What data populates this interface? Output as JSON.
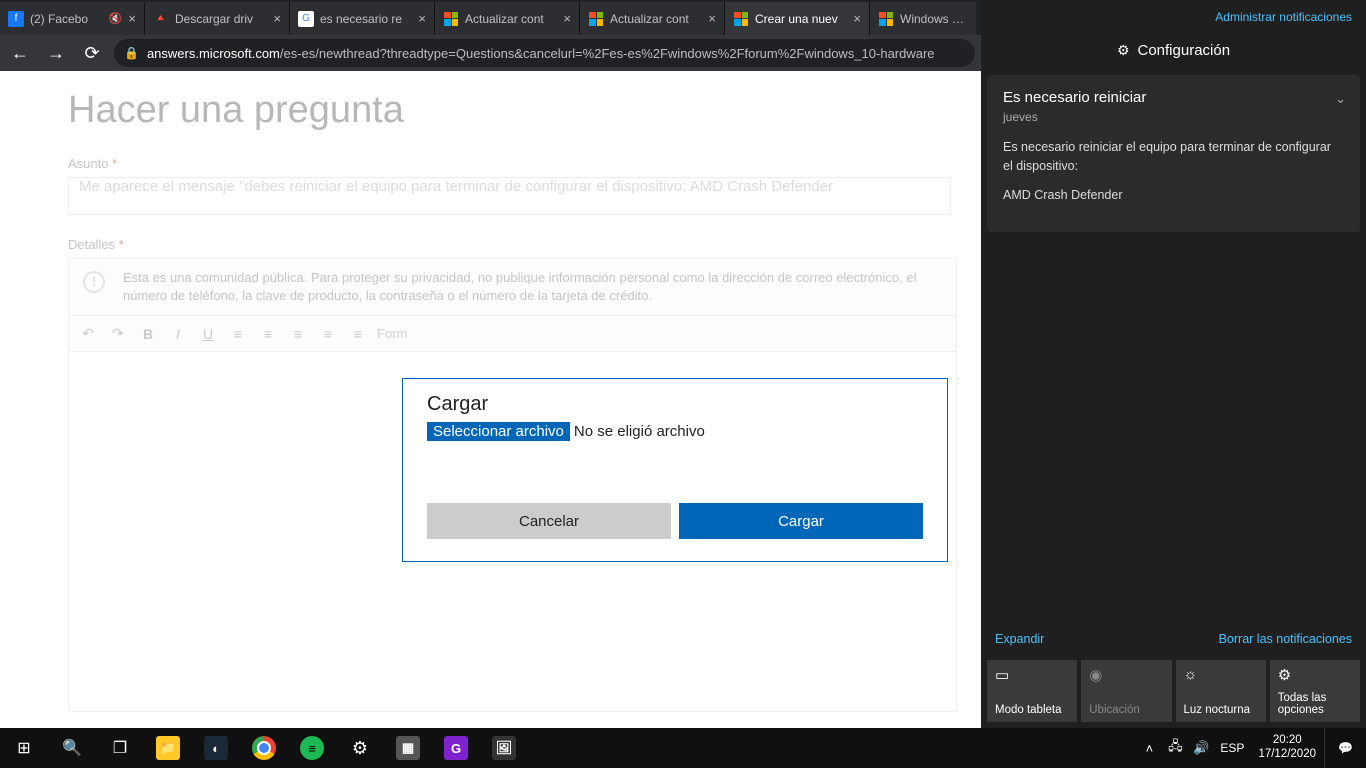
{
  "tabs": [
    {
      "title": "(2) Facebo",
      "muted": true
    },
    {
      "title": "Descargar driv"
    },
    {
      "title": "es necesario re"
    },
    {
      "title": "Actualizar cont"
    },
    {
      "title": "Actualizar cont"
    },
    {
      "title": "Crear una nuev",
      "active": true
    },
    {
      "title": "Windows Hard"
    }
  ],
  "url": {
    "host": "answers.microsoft.com",
    "path": "/es-es/newthread?threadtype=Questions&cancelurl=%2Fes-es%2Fwindows%2Fforum%2Fwindows_10-hardware"
  },
  "page": {
    "title": "Hacer una pregunta",
    "subject_label": "Asunto",
    "subject_value": "Me aparece el mensaje \"debes reiniciar el equipo para terminar de configurar el dispositivo: AMD Crash Defender",
    "details_label": "Detalles",
    "notice": "Esta es una comunidad pública. Para proteger su privacidad, no publique información personal como la dirección de correo electrónico, el número de teléfono, la clave de producto, la contraseña o el número de la tarjeta de crédito.",
    "format_label": "Form"
  },
  "modal": {
    "title": "Cargar",
    "choose_button": "Seleccionar archivo",
    "status": "No se eligió archivo",
    "cancel": "Cancelar",
    "upload": "Cargar"
  },
  "actionCenter": {
    "manage": "Administrar notificaciones",
    "config": "Configuración",
    "expand": "Expandir",
    "clear": "Borrar las notificaciones",
    "notification": {
      "title": "Es necesario reiniciar",
      "day": "jueves",
      "body": "Es necesario reiniciar el equipo para terminar de configurar el dispositivo:",
      "device": "AMD Crash Defender"
    },
    "tiles": {
      "tablet": "Modo tableta",
      "location": "Ubicación",
      "nightlight": "Luz nocturna",
      "allsettings": "Todas las opciones"
    }
  },
  "taskbar": {
    "lang": "ESP",
    "time": "20:20",
    "date": "17/12/2020"
  }
}
